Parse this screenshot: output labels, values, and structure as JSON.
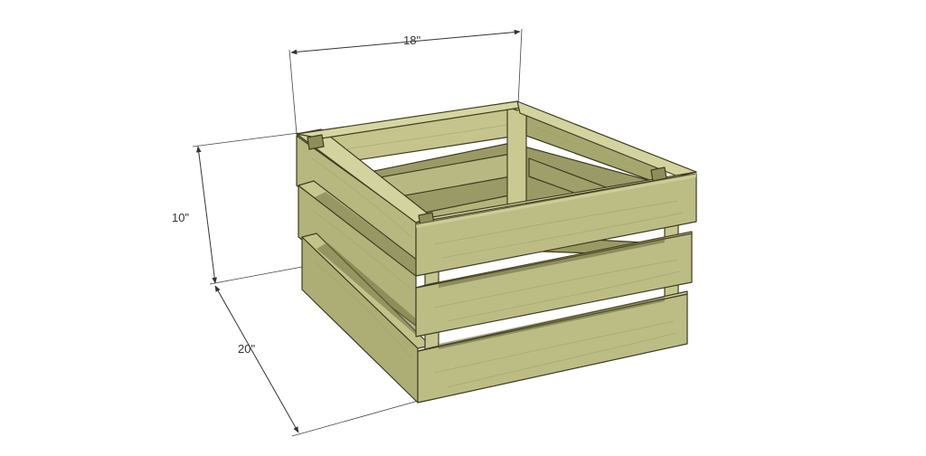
{
  "dimensions": {
    "width_label": "18\"",
    "height_label": "10\"",
    "depth_label": "20\""
  },
  "colors": {
    "wood_front": "#bcbd85",
    "wood_top": "#cfcf9a",
    "wood_side": "#a9aa71",
    "wood_dark": "#8b8c55",
    "edge": "#3f3d22",
    "dimension_line": "#333333"
  }
}
